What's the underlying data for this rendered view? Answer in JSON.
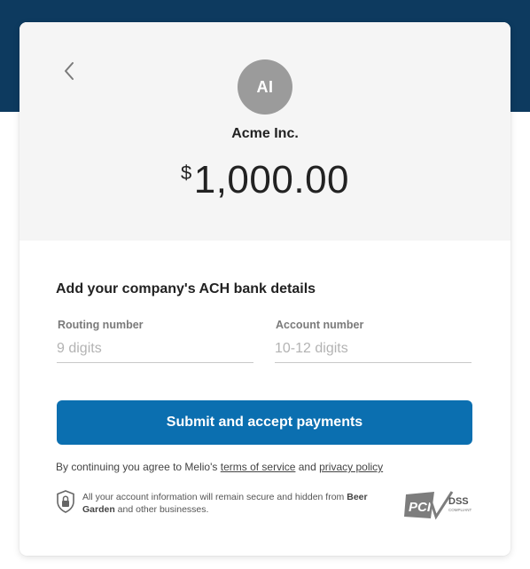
{
  "header": {
    "avatar_initials": "AI",
    "company_name": "Acme Inc.",
    "currency_symbol": "$",
    "amount": "1,000.00"
  },
  "form": {
    "title": "Add your company's ACH bank details",
    "routing": {
      "label": "Routing number",
      "placeholder": "9 digits",
      "value": ""
    },
    "account": {
      "label": "Account number",
      "placeholder": "10-12 digits",
      "value": ""
    },
    "submit_label": "Submit and accept payments"
  },
  "terms": {
    "prefix": "By continuing you agree to Melio's ",
    "tos_link": "terms of service",
    "and": " and ",
    "privacy_link": "privacy policy"
  },
  "security": {
    "text_before": "All your account information will remain secure and hidden from ",
    "company": "Beer Garden",
    "text_after": " and other businesses."
  },
  "badge": {
    "pci_text": "PCI",
    "dss_text": "DSS",
    "compliant_text": "COMPLIANT"
  },
  "colors": {
    "topbar": "#0d3a5f",
    "primary_button": "#0b6fb0",
    "avatar": "#9b9b9b",
    "header_bg": "#f5f5f5"
  },
  "icons": {
    "back": "chevron-left-icon",
    "security": "lock-shield-icon",
    "badge": "pci-dss-badge"
  }
}
